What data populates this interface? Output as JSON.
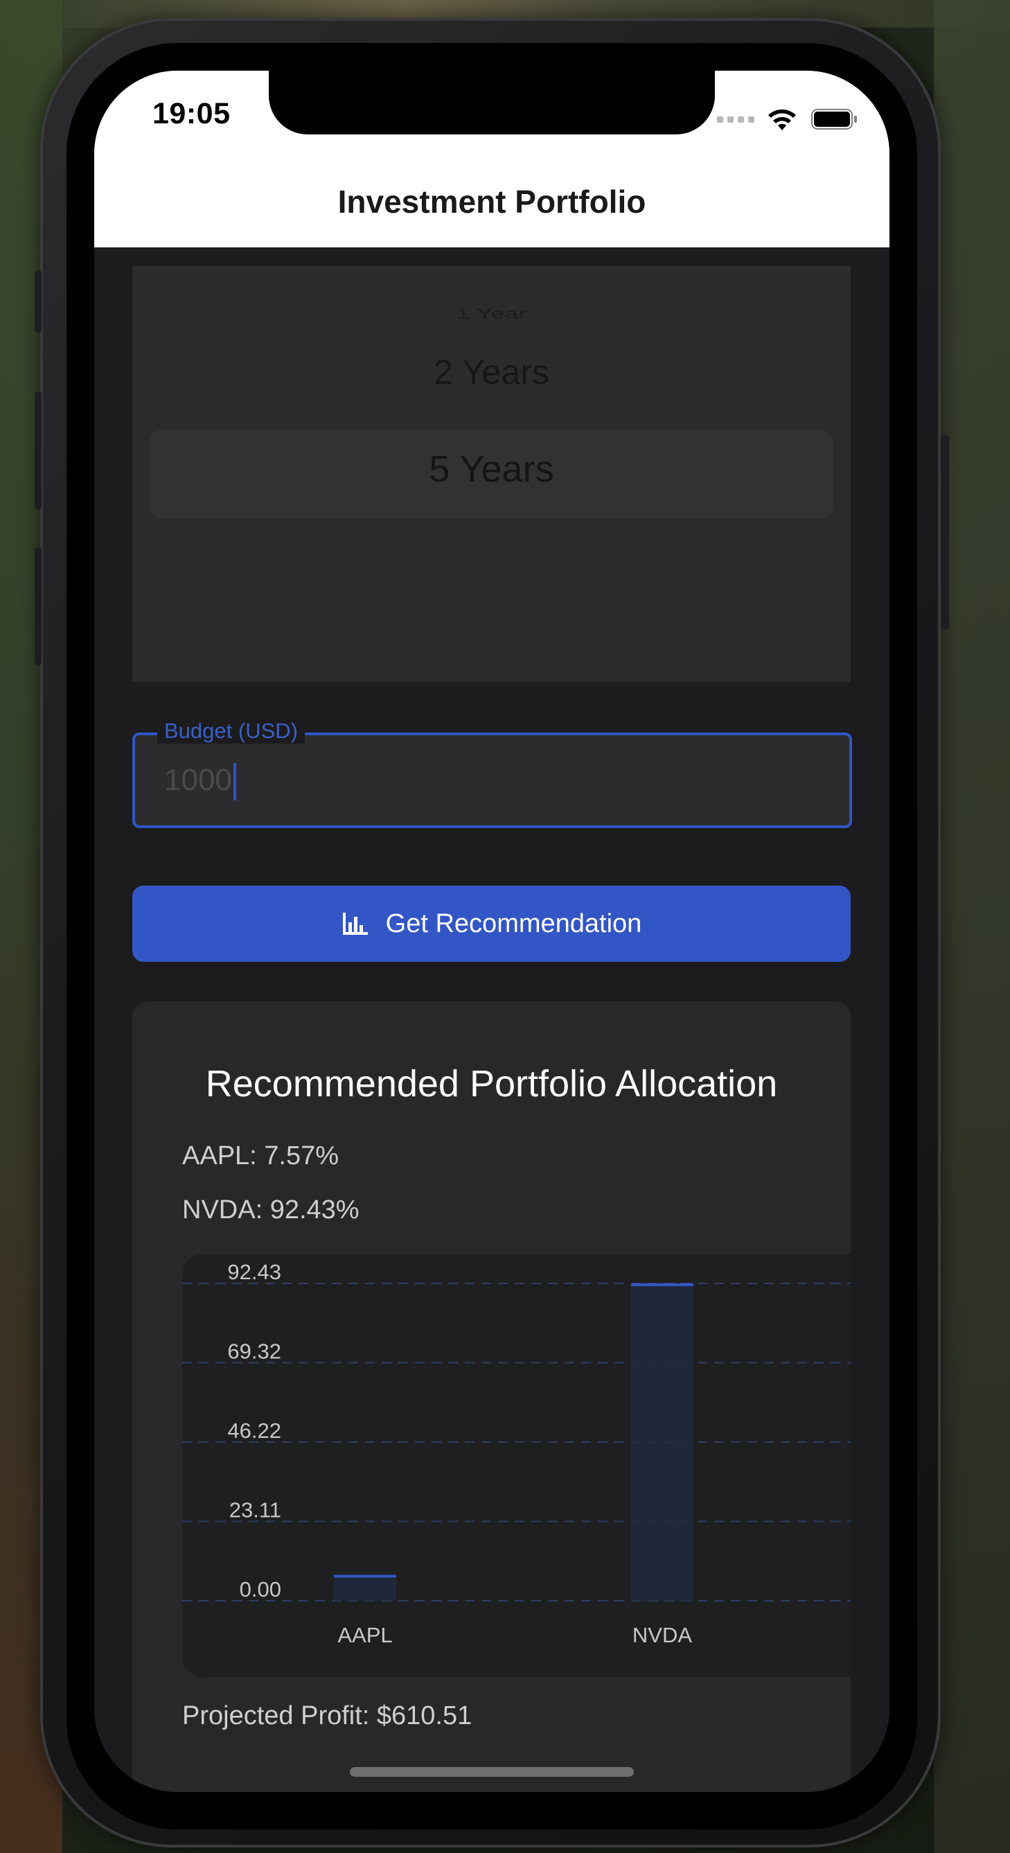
{
  "status_bar": {
    "time": "19:05"
  },
  "header": {
    "title": "Investment Portfolio"
  },
  "picker": {
    "options": [
      "1 Year",
      "2 Years",
      "5 Years"
    ],
    "selected": "5 Years"
  },
  "budget_input": {
    "label": "Budget (USD)",
    "value": "1000"
  },
  "button": {
    "label": "Get Recommendation",
    "icon": "bar-chart-icon"
  },
  "card": {
    "title": "Recommended Portfolio Allocation",
    "allocations": [
      "AAPL: 7.57%",
      "NVDA: 92.43%"
    ],
    "projected_profit": "Projected Profit: $610.51"
  },
  "colors": {
    "accent": "#3356c6",
    "background": "#1c1c1e",
    "card": "#28282a",
    "header": "#ffffff"
  },
  "chart_data": {
    "type": "bar",
    "categories": [
      "AAPL",
      "NVDA"
    ],
    "values": [
      7.57,
      92.43
    ],
    "ytick_labels": [
      "92.43",
      "69.32",
      "46.22",
      "23.11",
      "0.00"
    ],
    "ylim": [
      0,
      92.43
    ],
    "grid": true,
    "title": "",
    "xlabel": "",
    "ylabel": ""
  }
}
